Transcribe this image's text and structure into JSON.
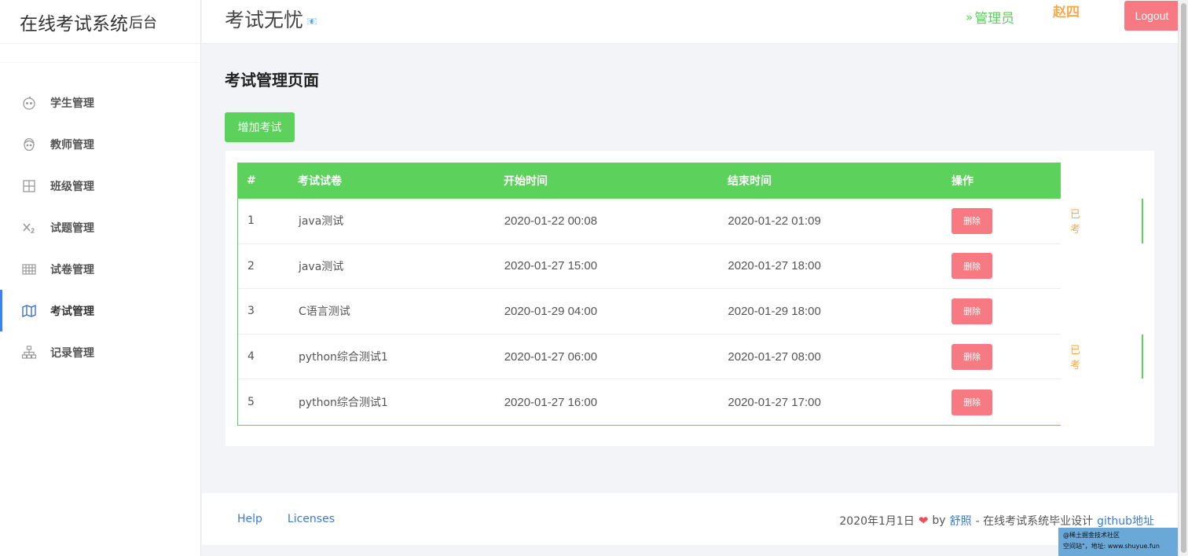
{
  "sidebar": {
    "brand_big": "在线考试系统",
    "brand_small": "后台",
    "items": [
      {
        "label": "学生管理",
        "icon": "baby-face-icon"
      },
      {
        "label": "教师管理",
        "icon": "face-icon"
      },
      {
        "label": "班级管理",
        "icon": "grid-icon"
      },
      {
        "label": "试题管理",
        "icon": "subscript-icon"
      },
      {
        "label": "试卷管理",
        "icon": "table-icon"
      },
      {
        "label": "考试管理",
        "icon": "map-icon",
        "active": true
      },
      {
        "label": "记录管理",
        "icon": "sitemap-icon"
      }
    ]
  },
  "header": {
    "site_title": "考试无忧",
    "site_tiny": "📧",
    "role_icon": "»",
    "role": "管理员",
    "user": "赵四",
    "logout": "Logout"
  },
  "main": {
    "page_title": "考试管理页面",
    "add_button": "增加考试",
    "table": {
      "headers": [
        "#",
        "考试试卷",
        "开始时间",
        "结束时间",
        "操作"
      ],
      "rows": [
        {
          "num": "1",
          "name": "java测试",
          "start": "2020-01-22 00:08",
          "end": "2020-01-22 01:09",
          "op": "删除",
          "status": "已考"
        },
        {
          "num": "2",
          "name": "java测试",
          "start": "2020-01-27 15:00",
          "end": "2020-01-27 18:00",
          "op": "删除",
          "status": ""
        },
        {
          "num": "3",
          "name": "C语言测试",
          "start": "2020-01-29 04:00",
          "end": "2020-01-29 18:00",
          "op": "删除",
          "status": ""
        },
        {
          "num": "4",
          "name": "python综合测试1",
          "start": "2020-01-27 06:00",
          "end": "2020-01-27 08:00",
          "op": "删除",
          "status": "已考"
        },
        {
          "num": "5",
          "name": "python综合测试1",
          "start": "2020-01-27 16:00",
          "end": "2020-01-27 17:00",
          "op": "删除",
          "status": ""
        }
      ]
    }
  },
  "footer": {
    "help": "Help",
    "licenses": "Licenses",
    "date": "2020年1月1日",
    "by": "by",
    "author": "舒照",
    "desc": "- 在线考试系统毕业设计",
    "github": "github地址"
  },
  "watermark": {
    "line1": "@稀土掘金技术社区",
    "line2": "空间站\"，地址: www.shuyue.fun"
  },
  "colors": {
    "green": "#5cd15c",
    "red": "#f77a82",
    "orange": "#f6a94a",
    "blue": "#3a7bd5",
    "active_bar": "#3b82f6"
  }
}
